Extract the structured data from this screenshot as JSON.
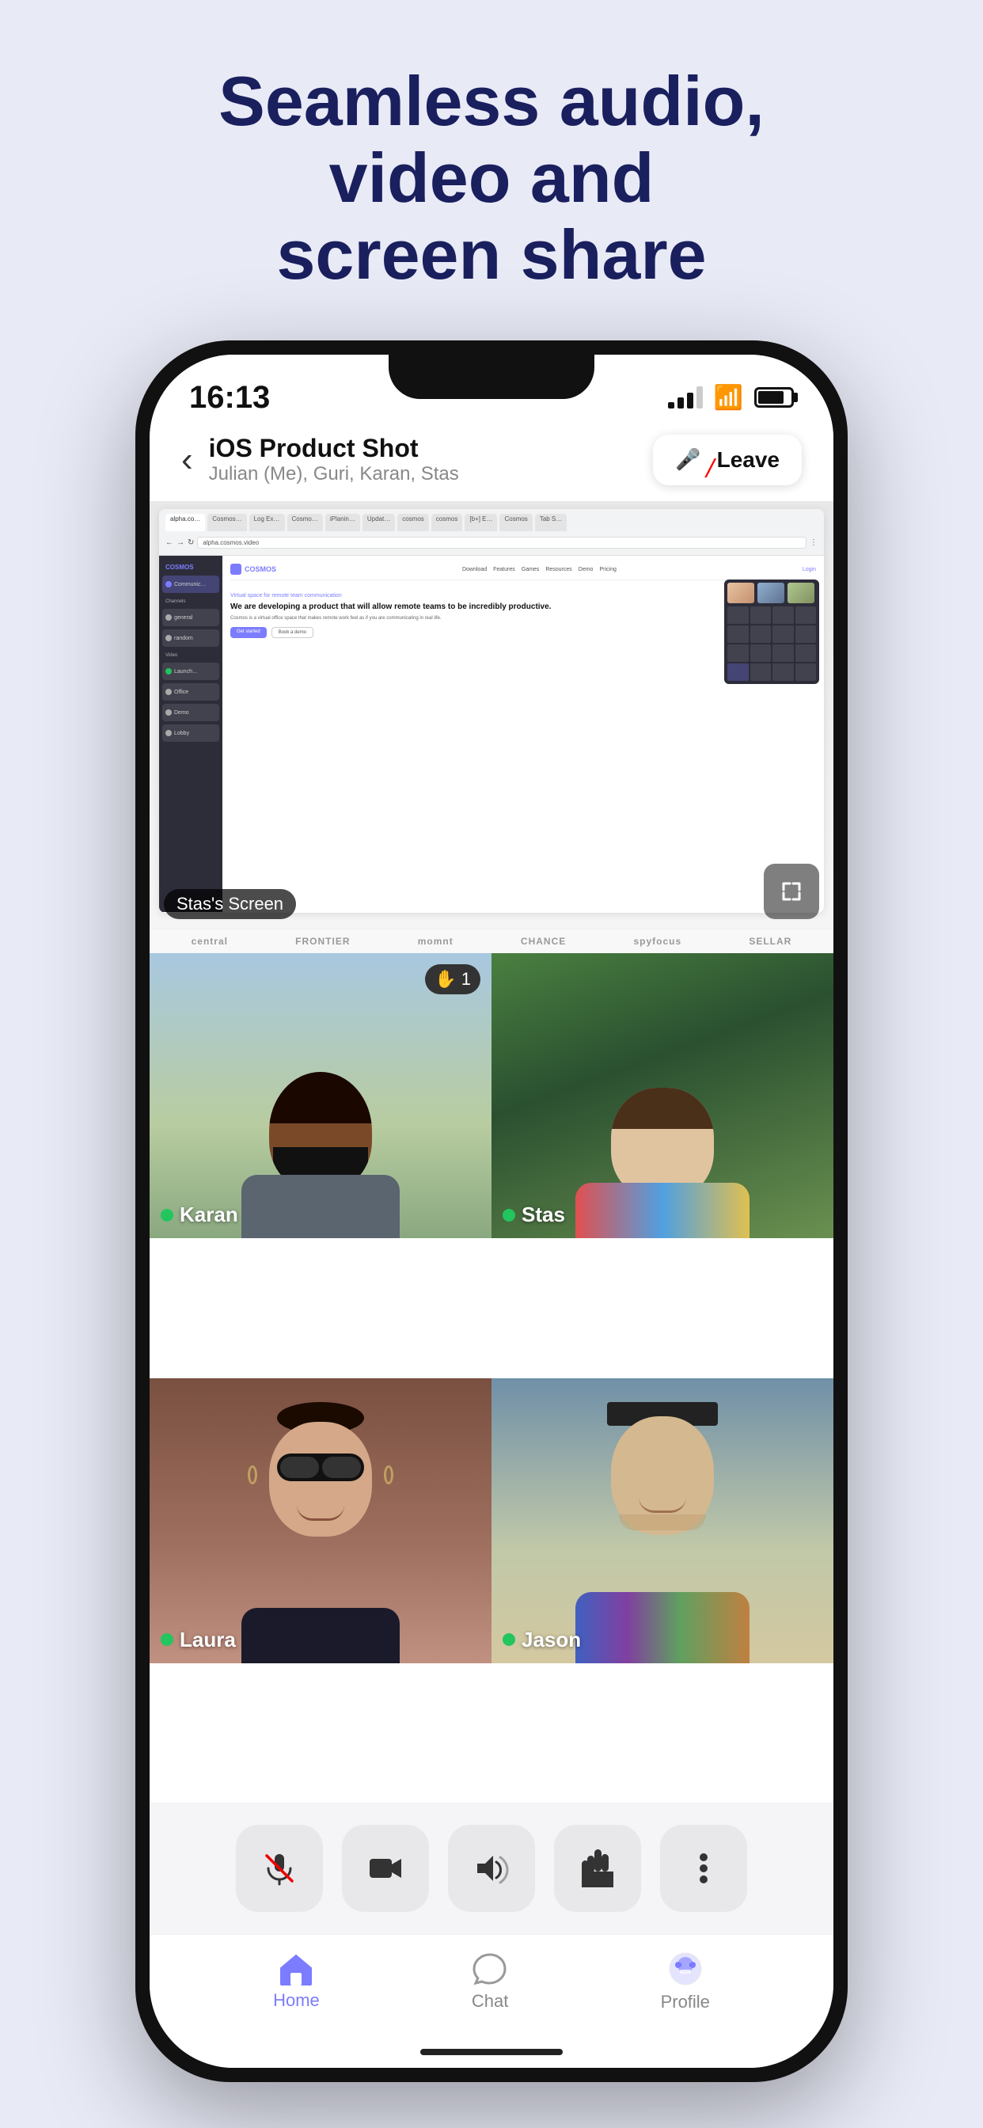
{
  "headline": {
    "line1": "Seamless audio, video and",
    "line2": "screen share"
  },
  "statusBar": {
    "time": "16:13",
    "signal": "signal",
    "wifi": "wifi",
    "battery": "battery"
  },
  "callHeader": {
    "back": "‹",
    "roomName": "iOS Product Shot",
    "participants": "Julian (Me), Guri, Karan, Stas",
    "leaveLabel": "Leave"
  },
  "screenShare": {
    "label": "Stas's Screen",
    "browserUrl": "alpha.cosmos.video",
    "cosmosBrand": "COSMOS",
    "cosmoTagline": "Virtual space for remote team communication",
    "cosmosHero": "We are developing a product that will allow remote teams to be incredibly productive.",
    "cosmosDesc": "Cosmos is a virtual office space that makes remote work feel as if you are communicating in real life.",
    "btnGetStarted": "Get started",
    "btnBookDemo": "Book a demo"
  },
  "brandBar": {
    "brands": [
      "central",
      "FRONTIER",
      "momnt",
      "CHANCE",
      "spyfocus",
      "SELLAR"
    ]
  },
  "participants": [
    {
      "name": "Karan",
      "active": true,
      "raiseHand": true,
      "handCount": 1,
      "bg": "karan"
    },
    {
      "name": "Stas",
      "active": true,
      "raiseHand": false,
      "bg": "stas"
    },
    {
      "name": "Laura",
      "active": true,
      "raiseHand": false,
      "bg": "laura"
    },
    {
      "name": "Jason",
      "active": true,
      "raiseHand": false,
      "bg": "jason"
    }
  ],
  "controls": {
    "mute": {
      "label": "mute",
      "icon": "🎤",
      "muted": true
    },
    "video": {
      "label": "video",
      "icon": "📷"
    },
    "volume": {
      "label": "volume",
      "icon": "🔊"
    },
    "hand": {
      "label": "raise hand",
      "icon": "✋"
    },
    "more": {
      "label": "more",
      "icon": "⋮"
    }
  },
  "tabBar": {
    "tabs": [
      {
        "id": "home",
        "label": "Home",
        "icon": "⌂",
        "active": false
      },
      {
        "id": "chat",
        "label": "Chat",
        "icon": "💬",
        "active": false
      },
      {
        "id": "profile",
        "label": "Profile",
        "icon": "👾",
        "active": false
      }
    ]
  }
}
